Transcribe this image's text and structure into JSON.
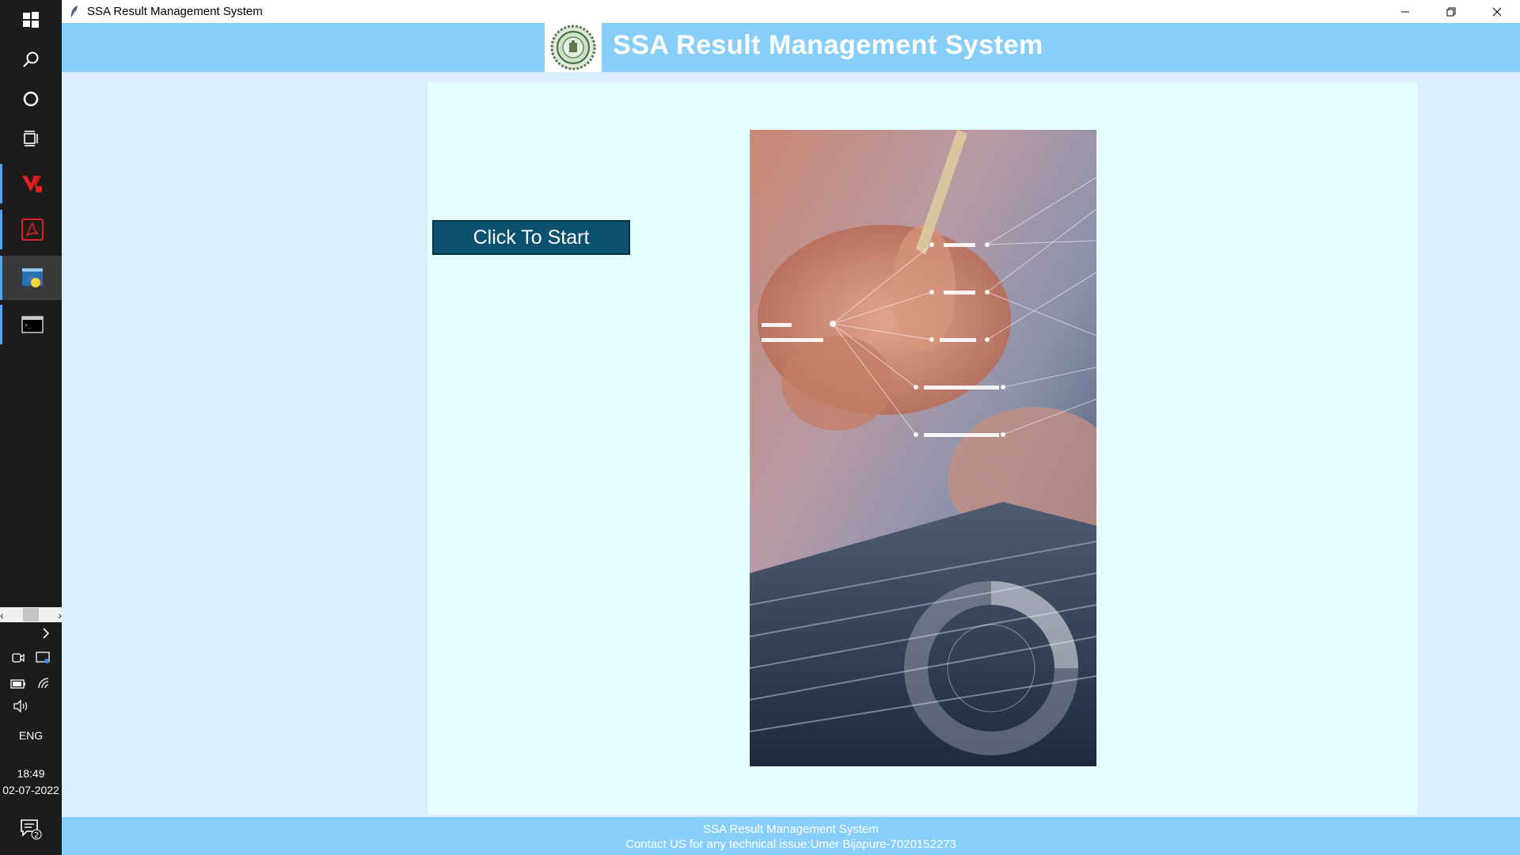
{
  "window": {
    "title": "SSA Result Management System"
  },
  "taskbar": {
    "icons": [
      "windows-start-icon",
      "search-icon",
      "cortana-icon",
      "task-view-icon"
    ],
    "apps": [
      "vivaldi-browser-icon",
      "acrobat-reader-icon",
      "python-idle-icon",
      "terminal-icon"
    ],
    "tray": {
      "language": "ENG",
      "time": "18:49",
      "date": "02-07-2022",
      "notification_count": "2"
    }
  },
  "header": {
    "title": "SSA Result Management System",
    "logo": "college-emblem-logo"
  },
  "main": {
    "start_button_label": "Click To Start",
    "hero_image": "hands-on-laptop-network-illustration"
  },
  "footer": {
    "line1": "SSA Result Management System",
    "line2": "Contact US for any technical issue:Umer Bijapure-7020152273"
  },
  "colors": {
    "header_bg": "#87cefa",
    "page_bg": "#dbeefb",
    "panel_bg": "#e6fdff",
    "button_bg": "#0c5270",
    "taskbar_bg": "#1c1c1c"
  }
}
